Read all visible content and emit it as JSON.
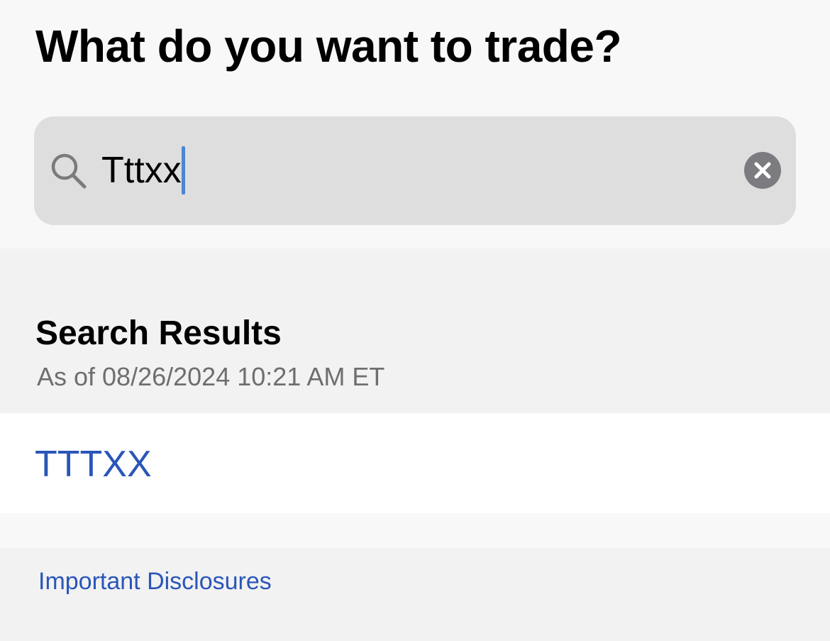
{
  "header": {
    "title": "What do you want to trade?"
  },
  "search": {
    "value": "Tttxx",
    "icon": "search-icon",
    "clear_icon": "close-icon"
  },
  "results": {
    "title": "Search Results",
    "timestamp": "As of 08/26/2024 10:21 AM ET",
    "items": [
      {
        "symbol": "TTTXX"
      }
    ]
  },
  "footer": {
    "disclosures_label": "Important Disclosures"
  },
  "colors": {
    "link": "#2a56b8",
    "caret": "#4a86d8",
    "search_bg": "#dedede",
    "clear_button": "#7c7c80"
  }
}
